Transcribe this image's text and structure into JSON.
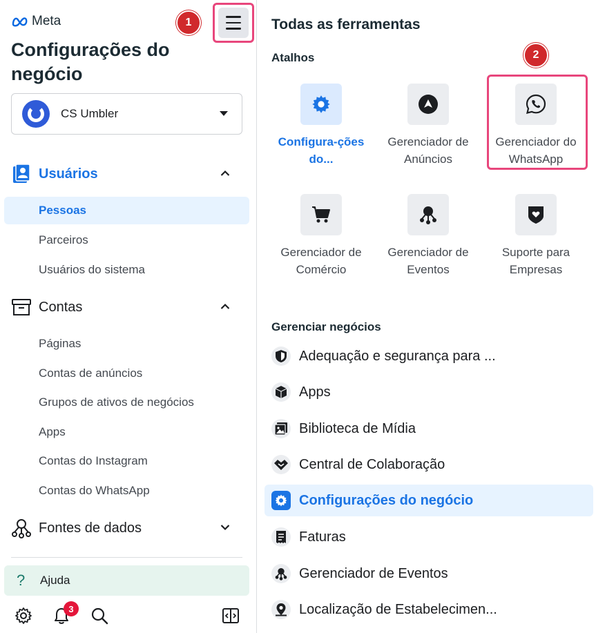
{
  "brand": {
    "logo_text": "Meta"
  },
  "page_title": "Configurações do negócio",
  "annotations": {
    "step1": "1",
    "step2": "2"
  },
  "account": {
    "name": "CS Umbler"
  },
  "sidebar": {
    "users_section": {
      "label": "Usuários",
      "items": [
        "Pessoas",
        "Parceiros",
        "Usuários do sistema"
      ]
    },
    "accounts_section": {
      "label": "Contas",
      "items": [
        "Páginas",
        "Contas de anúncios",
        "Grupos de ativos de negócios",
        "Apps",
        "Contas do Instagram",
        "Contas do WhatsApp"
      ]
    },
    "data_sources_section": {
      "label": "Fontes de dados"
    },
    "help": {
      "label": "Ajuda"
    },
    "notifications_count": "3"
  },
  "tools": {
    "title": "Todas as ferramentas",
    "shortcuts_label": "Atalhos",
    "shortcuts": [
      {
        "label": "Configura-ções do...",
        "icon": "gear-icon",
        "active": true
      },
      {
        "label": "Gerenciador de Anúncios",
        "icon": "ads-manager-icon"
      },
      {
        "label": "Gerenciador do WhatsApp",
        "icon": "whatsapp-icon"
      },
      {
        "label": "Gerenciador de Comércio",
        "icon": "cart-icon"
      },
      {
        "label": "Gerenciador de Eventos",
        "icon": "events-icon"
      },
      {
        "label": "Suporte para Empresas",
        "icon": "support-shield-icon"
      }
    ],
    "manage_label": "Gerenciar negócios",
    "manage_items": [
      {
        "label": "Adequação e segurança para ...",
        "icon": "shield-icon"
      },
      {
        "label": "Apps",
        "icon": "cube-icon"
      },
      {
        "label": "Biblioteca de Mídia",
        "icon": "media-library-icon"
      },
      {
        "label": "Central de Colaboração",
        "icon": "handshake-icon"
      },
      {
        "label": "Configurações do negócio",
        "icon": "gear-icon",
        "active": true
      },
      {
        "label": "Faturas",
        "icon": "invoice-icon"
      },
      {
        "label": "Gerenciador de Eventos",
        "icon": "events-icon"
      },
      {
        "label": "Localização de Estabelecimen...",
        "icon": "location-pin-icon"
      }
    ]
  },
  "colors": {
    "accent": "#1b74e4",
    "annotation_red": "#d0292c",
    "highlight_pink": "#e8467c",
    "active_bg": "#e7f3ff"
  }
}
